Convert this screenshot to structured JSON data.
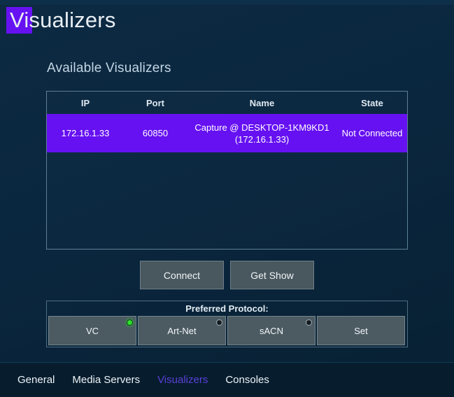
{
  "window": {
    "title": "Visualizers",
    "title_highlight_text": "Vi",
    "highlight_color": "#6611f2"
  },
  "main": {
    "section_heading": "Available Visualizers",
    "table": {
      "columns": [
        "IP",
        "Port",
        "Name",
        "State"
      ],
      "rows": [
        {
          "ip": "172.16.1.33",
          "port": "60850",
          "name": "Capture @ DESKTOP-1KM9KD1\n(172.16.1.33)",
          "state": "Not Connected",
          "selected": true
        }
      ]
    },
    "actions": {
      "connect_label": "Connect",
      "get_show_label": "Get Show"
    },
    "protocol": {
      "label": "Preferred Protocol:",
      "options": [
        {
          "label": "VC",
          "led": "on"
        },
        {
          "label": "Art-Net",
          "led": "off"
        },
        {
          "label": "sACN",
          "led": "off"
        }
      ],
      "set_label": "Set",
      "active_led_color": "#2ee02e"
    }
  },
  "nav": {
    "items": [
      {
        "label": "General",
        "active": false
      },
      {
        "label": "Media Servers",
        "active": false
      },
      {
        "label": "Visualizers",
        "active": true
      },
      {
        "label": "Consoles",
        "active": false
      }
    ],
    "active_color": "#5b3fd9"
  }
}
